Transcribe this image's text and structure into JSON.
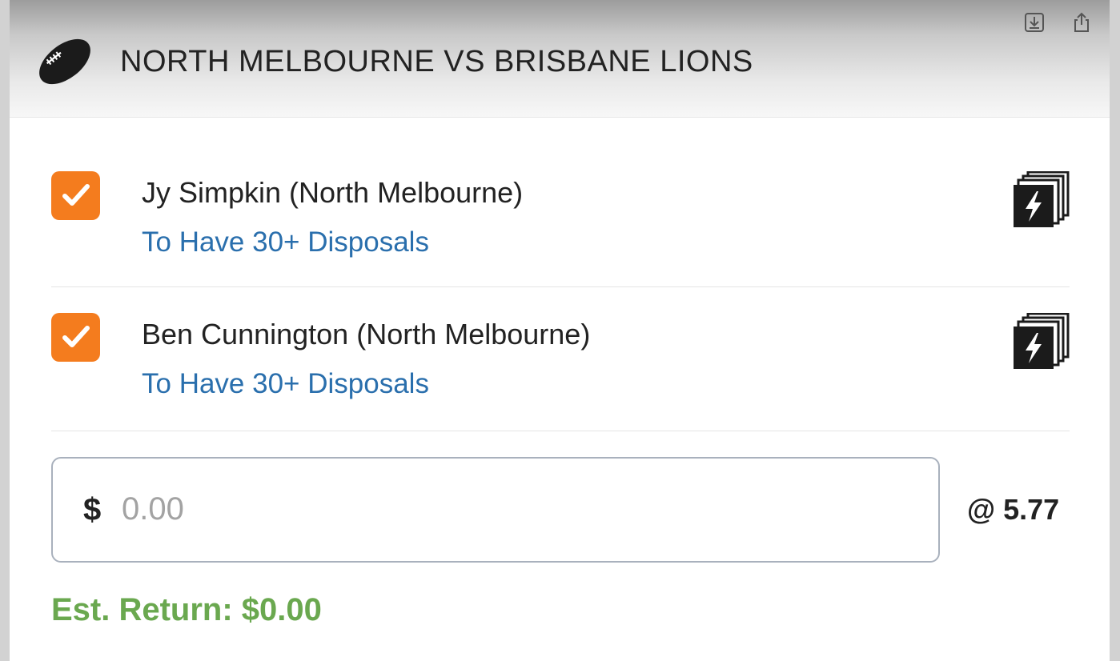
{
  "header": {
    "sport_icon": "football-icon",
    "title": "NORTH MELBOURNE VS BRISBANE LIONS",
    "actions": [
      {
        "icon": "download-icon"
      },
      {
        "icon": "share-icon"
      }
    ]
  },
  "legs": [
    {
      "checked": true,
      "selection": "Jy Simpkin (North Melbourne)",
      "market": "To Have 30+ Disposals",
      "icon": "same-game-multi-boost-icon"
    },
    {
      "checked": true,
      "selection": "Ben Cunnington (North Melbourne)",
      "market": "To Have 30+ Disposals",
      "icon": "same-game-multi-boost-icon"
    }
  ],
  "stake": {
    "currency_symbol": "$",
    "value": "",
    "placeholder": "0.00"
  },
  "odds": "@ 5.77",
  "est_return": "Est. Return: $0.00",
  "colors": {
    "checkbox": "#f47c1e",
    "market_link": "#2a6fad",
    "est_return": "#6aa84f"
  }
}
